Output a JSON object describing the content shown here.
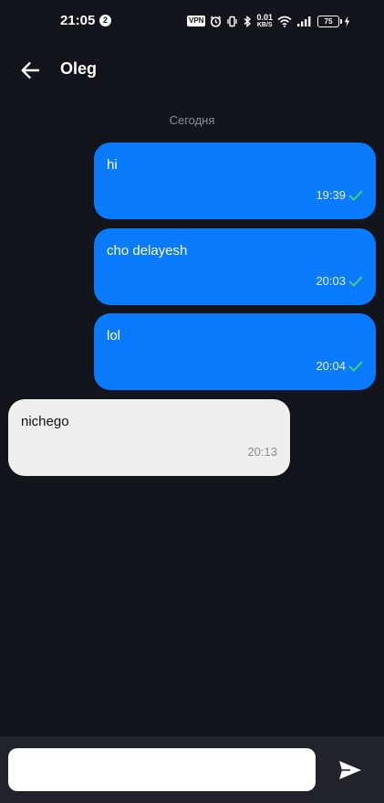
{
  "status_bar": {
    "time": "21:05",
    "notification_count": "2",
    "vpn_label": "VPN",
    "net_speed_value": "0.01",
    "net_speed_unit": "KB/S",
    "battery_level": "75"
  },
  "header": {
    "title": "Oleg",
    "back_icon": "arrow-left-icon"
  },
  "date_divider": "Сегодня",
  "messages": [
    {
      "direction": "outgoing",
      "text": "hi",
      "time": "19:39",
      "status": "read"
    },
    {
      "direction": "outgoing",
      "text": "cho delayesh",
      "time": "20:03",
      "status": "read"
    },
    {
      "direction": "outgoing",
      "text": "lol",
      "time": "20:04",
      "status": "read"
    },
    {
      "direction": "incoming",
      "text": "nichego",
      "time": "20:13"
    }
  ],
  "composer": {
    "input_value": "",
    "input_placeholder": "",
    "send_icon": "send-icon"
  },
  "colors": {
    "background": "#13151c",
    "outgoing_bubble": "#0a7bfc",
    "incoming_bubble": "#efefef",
    "read_check": "#4cd964",
    "composer_bar": "#22242b"
  }
}
